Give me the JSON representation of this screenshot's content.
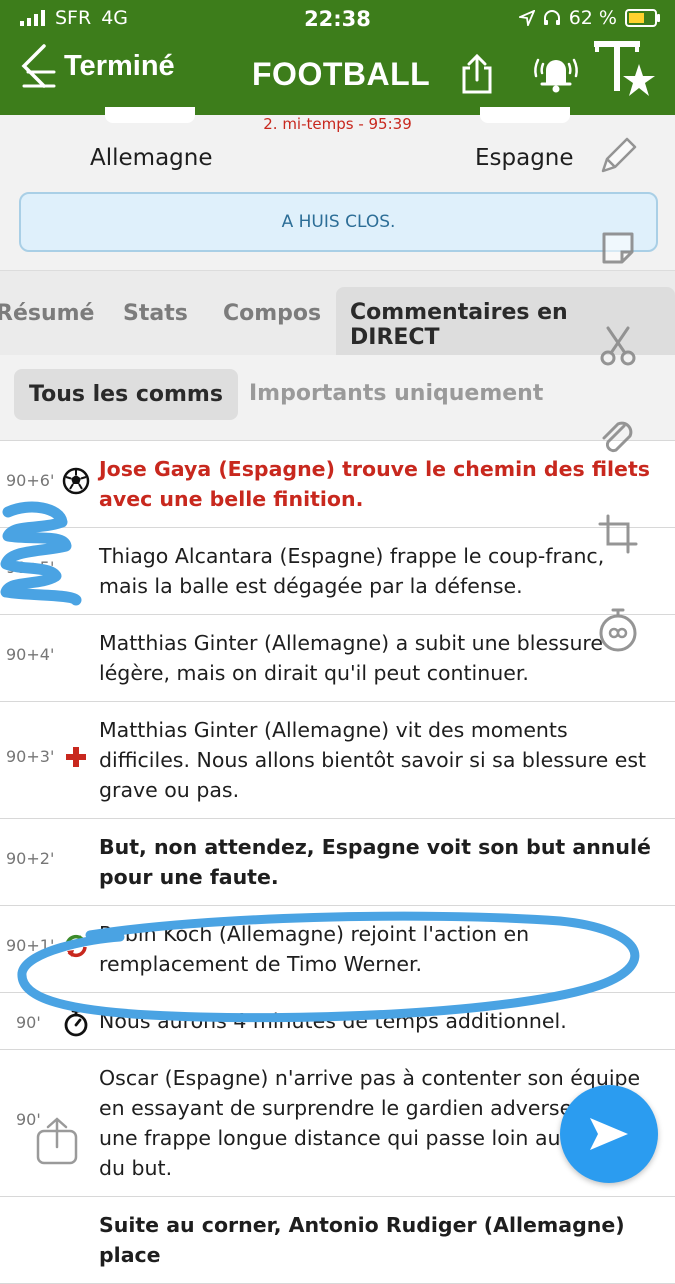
{
  "status_bar": {
    "carrier": "SFR",
    "network": "4G",
    "time": "22:38",
    "battery_pct": "62 %",
    "battery_level": 0.62
  },
  "nav": {
    "back_label": "Terminé",
    "title": "FOOTBALL"
  },
  "match": {
    "period": "2. mi-temps - 95:39",
    "home": "Allemagne",
    "away": "Espagne"
  },
  "notice": "A HUIS CLOS.",
  "tabs": [
    {
      "label": "Résumé",
      "active": false
    },
    {
      "label": "Stats",
      "active": false
    },
    {
      "label": "Compos",
      "active": false
    },
    {
      "label": "Commentaires en DIRECT",
      "active": true
    }
  ],
  "filters": [
    {
      "label": "Tous les comms",
      "active": true
    },
    {
      "label": "Importants uniquement",
      "active": false
    }
  ],
  "feed": [
    {
      "minute": "90+6'",
      "icon": "soccer-ball-icon",
      "style": "red",
      "text": "Jose Gaya (Espagne) trouve le chemin des filets avec une belle finition."
    },
    {
      "minute": "90+5'",
      "icon": "",
      "style": "normal",
      "text": "Thiago Alcantara (Espagne) frappe le coup-franc, mais la balle est dégagée par la défense."
    },
    {
      "minute": "90+4'",
      "icon": "",
      "style": "normal",
      "text": "Matthias Ginter (Allemagne) a subit une blessure légère, mais on dirait qu'il peut continuer."
    },
    {
      "minute": "90+3'",
      "icon": "medical-cross-icon",
      "style": "normal",
      "text": "Matthias Ginter (Allemagne) vit des moments difficiles. Nous allons bientôt savoir si sa blessure est grave ou pas."
    },
    {
      "minute": "90+2'",
      "icon": "",
      "style": "bold",
      "text": "But, non attendez, Espagne voit son but annulé pour une faute."
    },
    {
      "minute": "90+1'",
      "icon": "substitution-icon",
      "style": "normal",
      "text": "Robin Koch (Allemagne) rejoint l'action en remplacement de Timo Werner."
    },
    {
      "minute": "90'",
      "icon": "stopwatch-icon",
      "style": "normal",
      "text": "Nous aurons 4 minutes de temps additionnel."
    },
    {
      "minute": "90'",
      "icon": "",
      "style": "normal",
      "text": "Oscar (Espagne) n'arrive pas à contenter son équipe en essayant de surprendre le gardien adverse avec une frappe longue distance qui passe loin au-dessus du but."
    },
    {
      "minute": "",
      "icon": "",
      "style": "bold",
      "text": "Suite au corner, Antonio Rudiger (Allemagne) place"
    }
  ],
  "colors": {
    "header_green": "#3d7d1b",
    "goal_red": "#c8281e",
    "annotation_blue": "#4aa3e3",
    "fab_blue": "#2b9cf0"
  }
}
